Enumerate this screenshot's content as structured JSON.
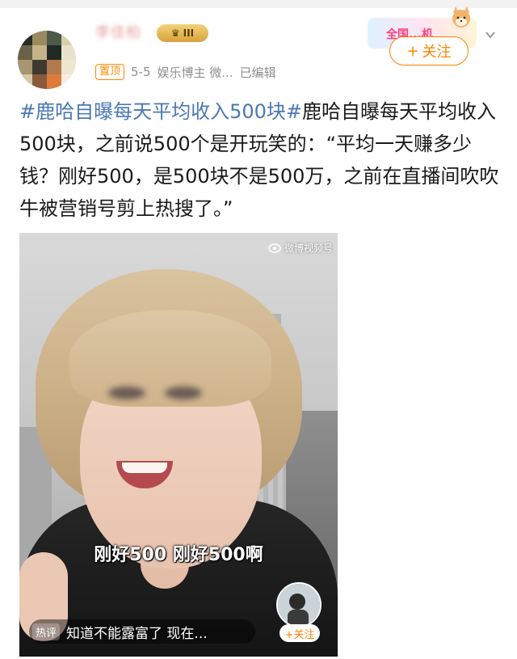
{
  "post": {
    "username": "李佳柏",
    "level_badge": "III",
    "pin_tag": "置顶",
    "date": "5-5",
    "author_label": "娱乐博主 微...",
    "edited_label": "已编辑",
    "follow_label": "关注",
    "promo_text": "全国...机",
    "hashtag": "#鹿哈自曝每天平均收入500块#",
    "body": "鹿哈自曝每天平均收入500块，之前说500个是开玩笑的：“平均一天赚多少钱？刚好500，是500块不是500万，之前在直播间吹吹牛被营销号剪上热搜了。”"
  },
  "video": {
    "watermark": "微博视频号",
    "subtitle": "刚好500 刚好500啊",
    "hot_badge": "热评",
    "hot_comment": "知道不能露富了  现在...",
    "mini_follow_label": "+关注"
  },
  "colors": {
    "accent": "#ff8200",
    "hashtag": "#4a78b4",
    "meta": "#8e8e8e"
  }
}
